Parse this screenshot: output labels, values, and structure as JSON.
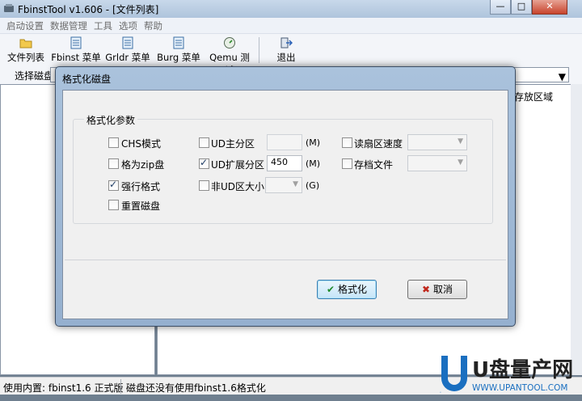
{
  "app": {
    "title": "FbinstTool v1.606 - [文件列表]"
  },
  "window_controls": {
    "minimize": "—",
    "maximize": "□",
    "close": "✕"
  },
  "menu": [
    "启动设置",
    "数据管理",
    "工具",
    "选项",
    "帮助"
  ],
  "toolbar": {
    "file_list": "文件列表",
    "fbinst_menu": "Fbinst 菜单",
    "grldr_menu": "Grldr 菜单",
    "burg_menu": "Burg 菜单",
    "qemu_test": "Qemu 测试",
    "exit": "退出"
  },
  "disk": {
    "label": "选择磁盘"
  },
  "right_pane": {
    "area_header": "存放区域"
  },
  "status": {
    "left": "使用内置: fbinst1.6 正式版",
    "right": "磁盘还没有使用fbinst1.6格式化"
  },
  "dialog": {
    "title": "格式化磁盘",
    "group_title": "格式化参数",
    "options": {
      "chs_mode": {
        "label": "CHS模式",
        "checked": false
      },
      "zip_disk": {
        "label": "格为zip盘",
        "checked": false
      },
      "force_format": {
        "label": "强行格式",
        "checked": true
      },
      "reset_disk": {
        "label": "重置磁盘",
        "checked": false
      },
      "ud_primary": {
        "label": "UD主分区",
        "checked": false,
        "value": ""
      },
      "ud_extended": {
        "label": "UD扩展分区",
        "checked": true,
        "value": "450"
      },
      "non_ud_size": {
        "label": "非UD区大小",
        "checked": false,
        "value": ""
      },
      "read_sector_speed": {
        "label": "读扇区速度",
        "checked": false,
        "value": ""
      },
      "archive_file": {
        "label": "存档文件",
        "checked": false,
        "value": ""
      }
    },
    "units": {
      "primary": "(M)",
      "extended": "(M)",
      "non_ud": "(G)"
    },
    "buttons": {
      "format": "格式化",
      "cancel": "取消"
    }
  },
  "watermark": {
    "brand": "U盘量产网",
    "url": "WWW.UPANTOOL.COM",
    "letter": "U"
  },
  "colors": {
    "accent": "#1f3d66",
    "check_green": "#1e8a2a",
    "cancel_red": "#c0281c",
    "watermark_blue": "#1a6fc0"
  }
}
